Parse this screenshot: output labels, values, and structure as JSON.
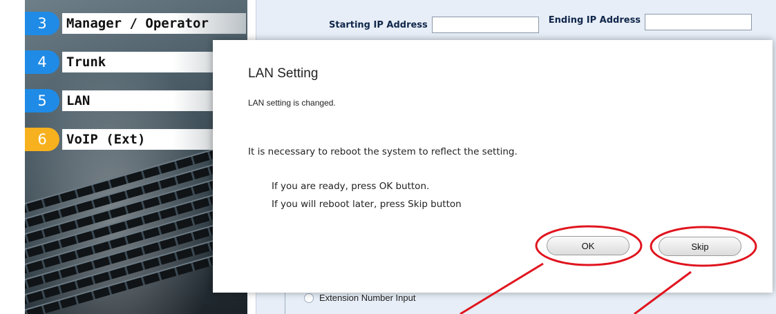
{
  "sidebar": {
    "items": [
      {
        "number": "3",
        "label": "Manager / Operator"
      },
      {
        "number": "4",
        "label": "Trunk"
      },
      {
        "number": "5",
        "label": "LAN"
      },
      {
        "number": "6",
        "label": "VoIP (Ext)"
      }
    ]
  },
  "background_page": {
    "starting_ip_label": "Starting IP Address",
    "starting_ip_value": "",
    "ending_ip_label": "Ending IP Address",
    "ending_ip_value": "",
    "extension_option_label": "Extension Number Input"
  },
  "dialog": {
    "title": "LAN Setting",
    "message_changed": "LAN setting is changed.",
    "message_reboot": "It is necessary to reboot the system to reflect the setting.",
    "message_ready": "If you are ready, press OK button.",
    "message_later": "If you will reboot later, press Skip button",
    "ok_label": "OK",
    "skip_label": "Skip"
  },
  "colors": {
    "menu_number_blue": "#1f8be6",
    "menu_number_orange": "#f7b11e",
    "annotation_red": "#e0141e"
  }
}
